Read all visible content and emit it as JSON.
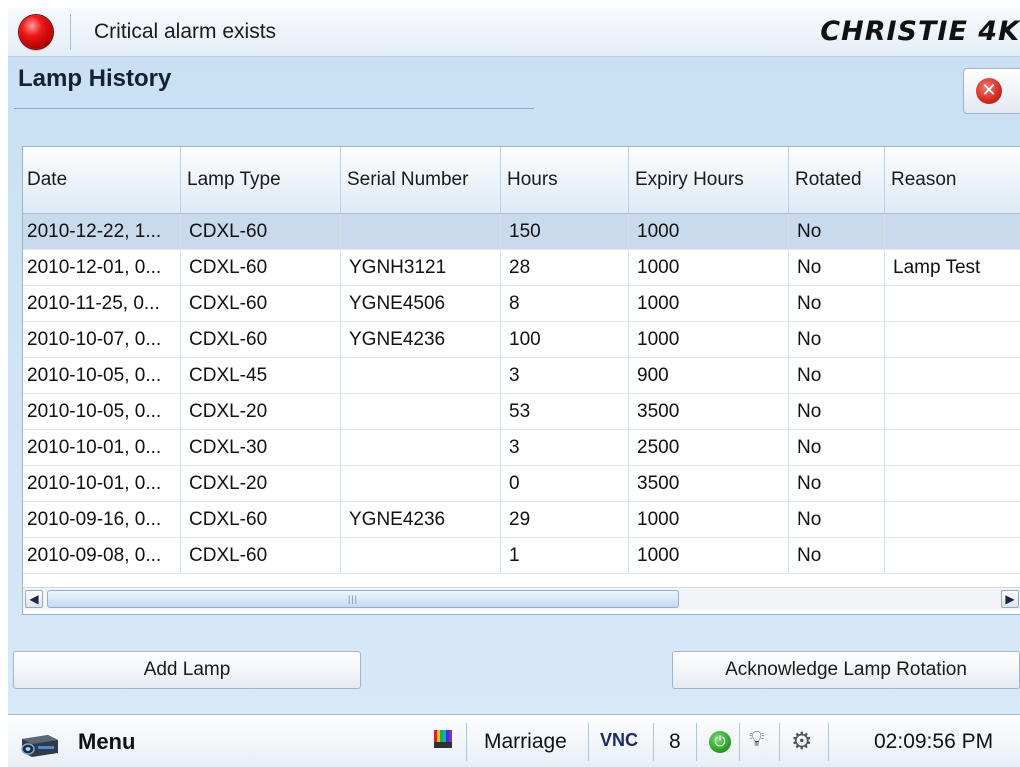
{
  "topbar": {
    "alarm_text": "Critical alarm exists",
    "brand": "CHRISTIE 4K",
    "icons": {
      "alarm": "red-alarm-light-icon"
    }
  },
  "page": {
    "title": "Lamp History",
    "close_icon": "close-icon"
  },
  "table": {
    "columns": [
      "Date",
      "Lamp Type",
      "Serial Number",
      "Hours",
      "Expiry Hours",
      "Rotated",
      "Reason"
    ],
    "rows": [
      [
        "2010-12-22, 1...",
        "CDXL-60",
        "",
        "150",
        "1000",
        "No",
        ""
      ],
      [
        "2010-12-01, 0...",
        "CDXL-60",
        "YGNH3121",
        "28",
        "1000",
        "No",
        "Lamp Test"
      ],
      [
        "2010-11-25, 0...",
        "CDXL-60",
        "YGNE4506",
        "8",
        "1000",
        "No",
        ""
      ],
      [
        "2010-10-07, 0...",
        "CDXL-60",
        "YGNE4236",
        "100",
        "1000",
        "No",
        ""
      ],
      [
        "2010-10-05, 0...",
        "CDXL-45",
        "",
        "3",
        "900",
        "No",
        ""
      ],
      [
        "2010-10-05, 0...",
        "CDXL-20",
        "",
        "53",
        "3500",
        "No",
        ""
      ],
      [
        "2010-10-01, 0...",
        "CDXL-30",
        "",
        "3",
        "2500",
        "No",
        ""
      ],
      [
        "2010-10-01, 0...",
        "CDXL-20",
        "",
        "0",
        "3500",
        "No",
        ""
      ],
      [
        "2010-09-16, 0...",
        "CDXL-60",
        "YGNE4236",
        "29",
        "1000",
        "No",
        ""
      ],
      [
        "2010-09-08, 0...",
        "CDXL-60",
        "",
        "1",
        "1000",
        "No",
        ""
      ]
    ],
    "selected_row": 0
  },
  "buttons": {
    "add_lamp": "Add Lamp",
    "acknowledge": "Acknowledge Lamp Rotation"
  },
  "taskbar": {
    "menu_label": "Menu",
    "marriage": "Marriage",
    "vnc": "VNC",
    "count": "8",
    "time": "02:09:56 PM",
    "icons": [
      "projector-icon",
      "test-pattern-icon",
      "power-icon",
      "lamp-bulb-icon",
      "settings-gear-icon"
    ]
  },
  "colors": {
    "background": "#cfe4f6",
    "selected_row": "#c8daec",
    "alarm": "#ee1818",
    "power": "#1d9a1d"
  }
}
